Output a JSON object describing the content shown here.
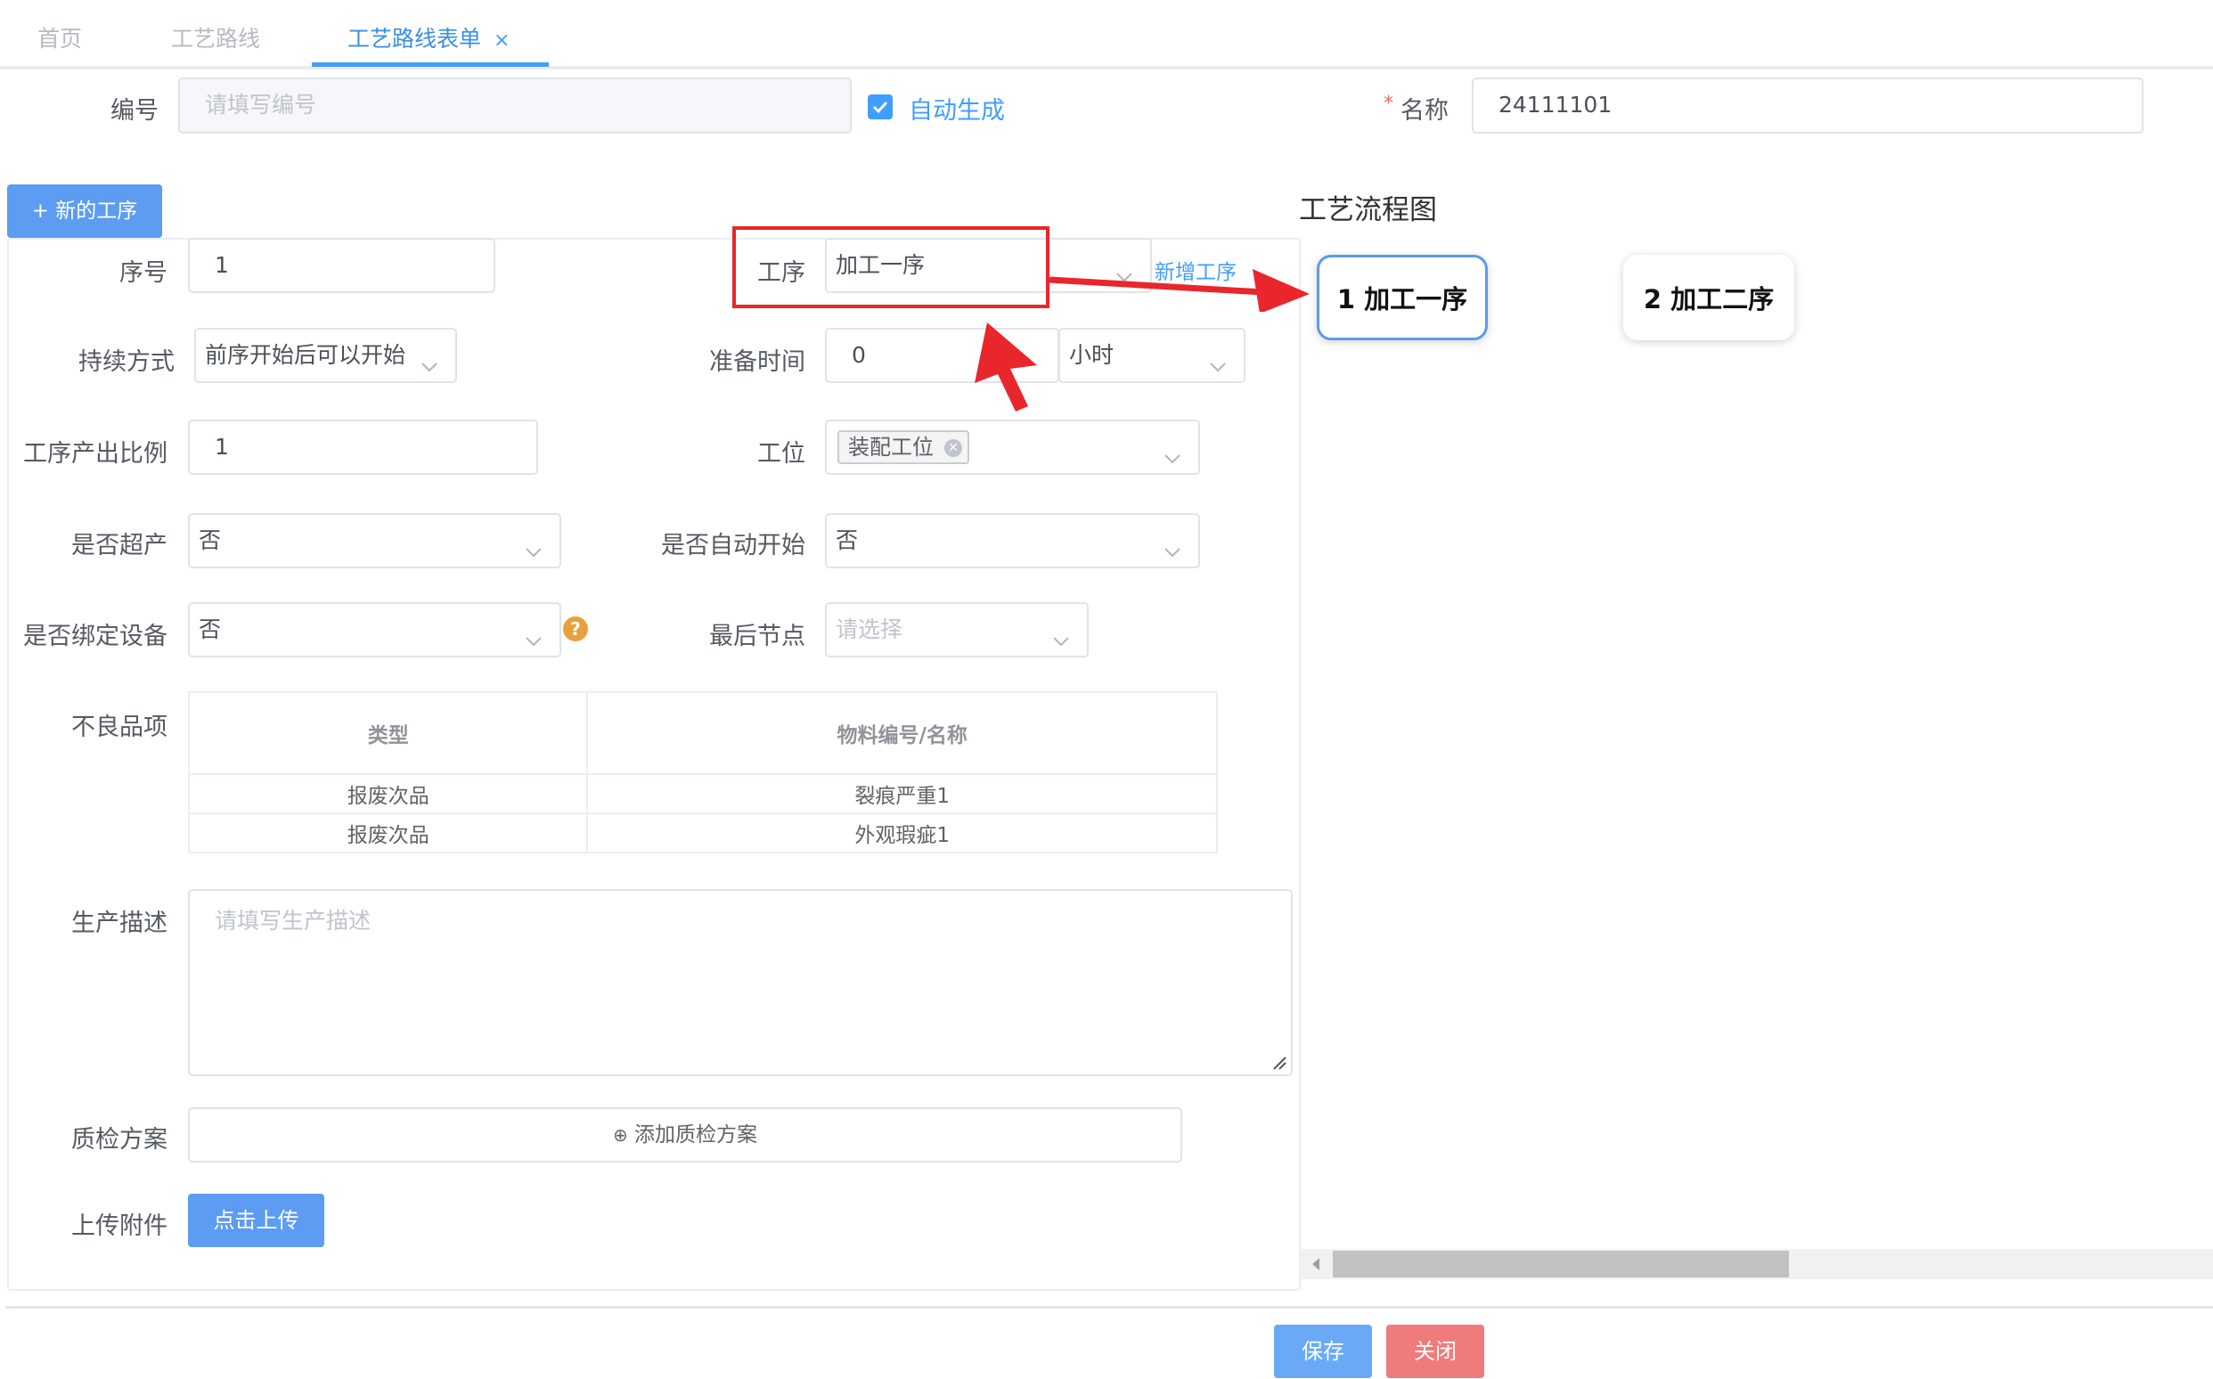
{
  "tabs": [
    {
      "label": "首页"
    },
    {
      "label": "工艺路线"
    },
    {
      "label": "工艺路线表单",
      "close": "×"
    }
  ],
  "header": {
    "code_label": "编号",
    "code_placeholder": "请填写编号",
    "auto_generate_label": "自动生成",
    "auto_generate_checked": true,
    "name_required_mark": "*",
    "name_label": "名称",
    "name_value": "24111101"
  },
  "new_process_button": "+ 新的工序",
  "flow_title": "工艺流程图",
  "form": {
    "seq_label": "序号",
    "seq_value": "1",
    "process_label": "工序",
    "process_value": "加工一序",
    "add_process_link": "新增工序",
    "duration_label": "持续方式",
    "duration_value": "前序开始后可以开始",
    "prep_time_label": "准备时间",
    "prep_time_value": "0",
    "prep_unit_value": "小时",
    "output_ratio_label": "工序产出比例",
    "output_ratio_value": "1",
    "station_label": "工位",
    "station_tag": "装配工位",
    "overproduce_label": "是否超产",
    "overproduce_value": "否",
    "auto_start_label": "是否自动开始",
    "auto_start_value": "否",
    "bind_device_label": "是否绑定设备",
    "bind_device_value": "否",
    "help_icon": "?",
    "last_node_label": "最后节点",
    "last_node_placeholder": "请选择",
    "defects_label": "不良品项",
    "defects_table": {
      "headers": [
        "类型",
        "物料编号/名称"
      ],
      "rows": [
        [
          "报废次品",
          "裂痕严重1"
        ],
        [
          "报废次品",
          "外观瑕疵1"
        ]
      ]
    },
    "desc_label": "生产描述",
    "desc_placeholder": "请填写生产描述",
    "qc_label": "质检方案",
    "qc_add": "添加质检方案",
    "upload_label": "上传附件",
    "upload_button": "点击上传"
  },
  "flow_nodes": [
    {
      "label": "1 加工一序",
      "active": true
    },
    {
      "label": "2 加工二序",
      "active": false
    }
  ],
  "footer": {
    "save": "保存",
    "close": "关闭"
  },
  "colors": {
    "primary": "#409eff",
    "danger": "#f56c6c",
    "annotation_red": "#e8262c"
  }
}
